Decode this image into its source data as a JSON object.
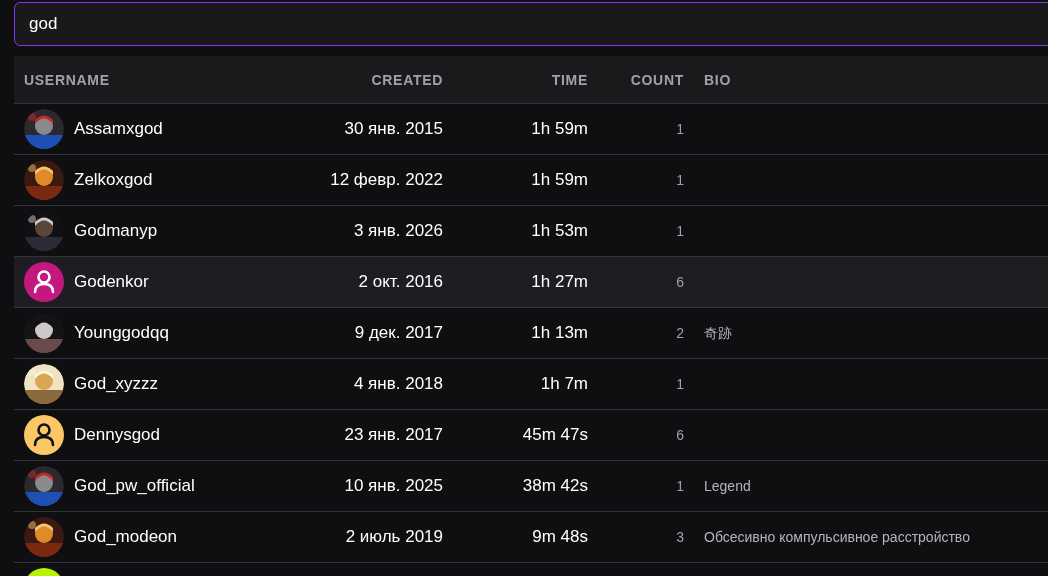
{
  "search": {
    "value": "god"
  },
  "table": {
    "columns": [
      {
        "label": "USERNAME",
        "kind": "user"
      },
      {
        "label": "CREATED",
        "kind": "date"
      },
      {
        "label": "TIME",
        "kind": "time"
      },
      {
        "label": "COUNT",
        "kind": "count"
      },
      {
        "label": "BIO",
        "kind": "bio"
      }
    ],
    "rows": [
      {
        "username": "Assamxgod",
        "created": "30 янв. 2015",
        "time": "1h 59m",
        "count": "1",
        "highlighted": false
      },
      {
        "username": "Zelkoxgod",
        "created": "12 февр. 2022",
        "time": "1h 59m",
        "count": "1",
        "highlighted": false
      },
      {
        "username": "Godmanyp",
        "created": "3 янв. 2026",
        "time": "1h 53m",
        "count": "1",
        "highlighted": false
      },
      {
        "avatar": {
          "kind": "default",
          "color": "#c2187f"
        },
        "username": "Godenkor",
        "created": "2 окт. 2016",
        "time": "1h 27m",
        "count": "6",
        "highlighted": true
      },
      {
        "username": "Younggodqq",
        "created": "9 дек. 2017",
        "time": "1h 13m",
        "count": "2",
        "bio": "奇跡",
        "highlighted": false
      },
      {
        "username": "God_xyzzz",
        "created": "4 янв. 2018",
        "time": "1h 7m",
        "count": "1",
        "highlighted": false
      },
      {
        "avatar": {
          "kind": "default",
          "color": "#fcc867"
        },
        "username": "Dennysgod",
        "created": "23 янв. 2017",
        "time": "45m 47s",
        "count": "6",
        "highlighted": false
      },
      {
        "username": "God_pw_official",
        "created": "10 янв. 2025",
        "time": "38m 42s",
        "count": "1",
        "bio": "Legend",
        "highlighted": false
      },
      {
        "username": "God_modeon",
        "created": "2 июль 2019",
        "time": "9m 48s",
        "count": "3",
        "bio": "Обсесивно компульсивное расстройство",
        "highlighted": false
      },
      {
        "avatar": {
          "kind": "default",
          "color": "#b8f200"
        },
        "highlighted": false
      }
    ]
  }
}
